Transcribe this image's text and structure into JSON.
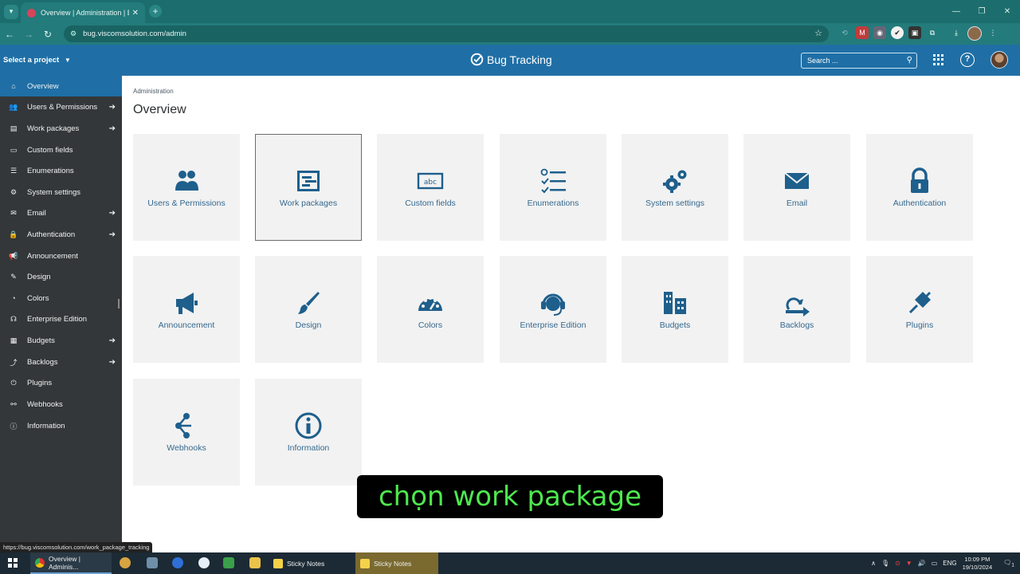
{
  "browser": {
    "tab_title": "Overview | Administration | Bug",
    "tab_close": "✕",
    "new_tab": "+",
    "url": "bug.viscomsolution.com/admin",
    "status_url": "https://bug.viscomsolution.com/work_package_tracking"
  },
  "header": {
    "project_select": "Select a project",
    "brand": "Bug Tracking",
    "search_placeholder": "Search ..."
  },
  "sidebar": {
    "items": [
      {
        "label": "Overview",
        "icon": "home-icon",
        "glyph": "⌂",
        "arrow": false,
        "active": true
      },
      {
        "label": "Users & Permissions",
        "icon": "users-icon",
        "glyph": "👥",
        "arrow": true
      },
      {
        "label": "Work packages",
        "icon": "work-packages-icon",
        "glyph": "▤",
        "arrow": true
      },
      {
        "label": "Custom fields",
        "icon": "custom-fields-icon",
        "glyph": "▭",
        "arrow": false
      },
      {
        "label": "Enumerations",
        "icon": "enumerations-icon",
        "glyph": "☰",
        "arrow": false
      },
      {
        "label": "System settings",
        "icon": "gears-icon",
        "glyph": "⚙",
        "arrow": false
      },
      {
        "label": "Email",
        "icon": "email-icon",
        "glyph": "✉",
        "arrow": true
      },
      {
        "label": "Authentication",
        "icon": "lock-icon",
        "glyph": "🔒",
        "arrow": true
      },
      {
        "label": "Announcement",
        "icon": "megaphone-icon",
        "glyph": "📢",
        "arrow": false
      },
      {
        "label": "Design",
        "icon": "brush-icon",
        "glyph": "✎",
        "arrow": false
      },
      {
        "label": "Colors",
        "icon": "palette-icon",
        "glyph": "◔",
        "arrow": false
      },
      {
        "label": "Enterprise Edition",
        "icon": "headset-icon",
        "glyph": "☊",
        "arrow": false
      },
      {
        "label": "Budgets",
        "icon": "budgets-icon",
        "glyph": "▦",
        "arrow": true
      },
      {
        "label": "Backlogs",
        "icon": "backlogs-icon",
        "glyph": "⤴",
        "arrow": true
      },
      {
        "label": "Plugins",
        "icon": "plug-icon",
        "glyph": "⏻",
        "arrow": false
      },
      {
        "label": "Webhooks",
        "icon": "webhooks-icon",
        "glyph": "⚯",
        "arrow": false
      },
      {
        "label": "Information",
        "icon": "info-icon",
        "glyph": "ⓘ",
        "arrow": false
      }
    ]
  },
  "main": {
    "breadcrumb": "Administration",
    "title": "Overview",
    "tiles": [
      {
        "label": "Users & Permissions",
        "icon": "users-icon"
      },
      {
        "label": "Work packages",
        "icon": "work-packages-icon",
        "selected": true
      },
      {
        "label": "Custom fields",
        "icon": "custom-fields-icon"
      },
      {
        "label": "Enumerations",
        "icon": "enumerations-icon"
      },
      {
        "label": "System settings",
        "icon": "gears-icon"
      },
      {
        "label": "Email",
        "icon": "email-icon"
      },
      {
        "label": "Authentication",
        "icon": "lock-icon"
      },
      {
        "label": "Announcement",
        "icon": "megaphone-icon"
      },
      {
        "label": "Design",
        "icon": "brush-icon"
      },
      {
        "label": "Colors",
        "icon": "palette-icon"
      },
      {
        "label": "Enterprise Edition",
        "icon": "headset-icon"
      },
      {
        "label": "Budgets",
        "icon": "budgets-icon"
      },
      {
        "label": "Backlogs",
        "icon": "backlogs-icon"
      },
      {
        "label": "Plugins",
        "icon": "plug-icon"
      },
      {
        "label": "Webhooks",
        "icon": "webhooks-icon"
      },
      {
        "label": "Information",
        "icon": "info-icon"
      }
    ]
  },
  "subtitle": "chọn work package",
  "taskbar": {
    "chrome_task": "Overview | Adminis...",
    "sticky_task_1": "Sticky Notes",
    "sticky_task_2": "Sticky Notes",
    "lang": "ENG",
    "time": "10:09 PM",
    "date": "19/10/2024",
    "notification_count": "1"
  },
  "colors": {
    "brand": "#1f6fa6",
    "sidebar": "#333739",
    "tile_bg": "#f2f2f2",
    "icon": "#1e5f8c",
    "subtitle_text": "#4ee84e"
  }
}
